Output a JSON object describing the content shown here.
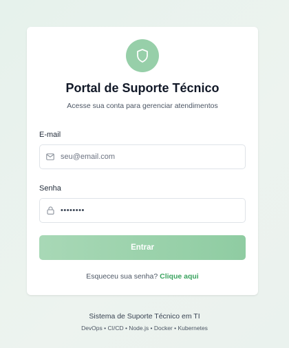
{
  "colors": {
    "accent": "#97cfa9",
    "button": "#99d1aa",
    "link": "#3aa35f",
    "background": "#e8f2ec"
  },
  "header": {
    "logo_icon": "shield-icon",
    "title": "Portal de Suporte Técnico",
    "subtitle": "Acesse sua conta para gerenciar atendimentos"
  },
  "form": {
    "email": {
      "label": "E-mail",
      "placeholder": "seu@email.com",
      "value": "",
      "icon": "mail-icon"
    },
    "password": {
      "label": "Senha",
      "value": "••••••••",
      "icon": "lock-icon"
    },
    "submit_label": "Entrar"
  },
  "forgot": {
    "text": "Esqueceu sua senha?",
    "link": "Clique aqui"
  },
  "footer": {
    "title": "Sistema de Suporte Técnico em TI",
    "tags": "DevOps • CI/CD • Node.js • Docker • Kubernetes"
  }
}
